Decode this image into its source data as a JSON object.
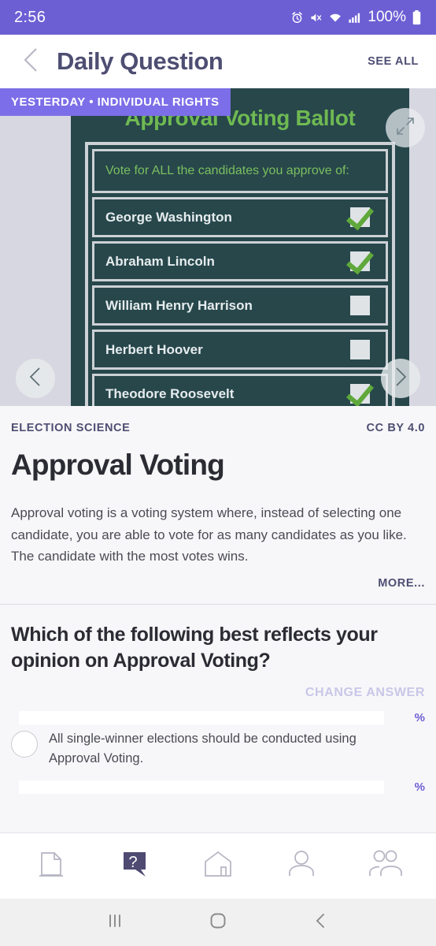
{
  "status_bar": {
    "time": "2:56",
    "battery_percent": "100%",
    "icons": [
      "alarm-icon",
      "mute-icon",
      "wifi-icon",
      "signal-icon",
      "battery-icon"
    ]
  },
  "header": {
    "back_icon": "chevron-left-icon",
    "title": "Daily Question",
    "see_all_label": "SEE ALL"
  },
  "hero": {
    "badge": "YESTERDAY  •  INDIVIDUAL RIGHTS",
    "expand_icon": "expand-icon",
    "prev_icon": "chevron-left-icon",
    "next_icon": "chevron-right-icon",
    "ballot": {
      "title": "Approval Voting Ballot",
      "prompt": "Vote for ALL the candidates you approve of:",
      "candidates": [
        {
          "name": "George Washington",
          "checked": true
        },
        {
          "name": "Abraham Lincoln",
          "checked": true
        },
        {
          "name": "William Henry Harrison",
          "checked": false
        },
        {
          "name": "Herbert Hoover",
          "checked": false
        },
        {
          "name": "Theodore Roosevelt",
          "checked": true
        }
      ]
    },
    "colors": {
      "ballot_bg": "#27474b",
      "ballot_green": "#6fb952",
      "gutter": "#d7d7e1"
    }
  },
  "article": {
    "category": "ELECTION SCIENCE",
    "license": "CC BY 4.0",
    "title": "Approval Voting",
    "body": "Approval voting is a voting system where, instead of selecting one candidate, you are able to vote for as many candidates as you like. The candidate with the most votes wins.",
    "more_label": "MORE..."
  },
  "question": {
    "text": "Which of the following best reflects your opinion on Approval Voting?",
    "change_answer_label": "CHANGE ANSWER",
    "options": [
      {
        "label": "All single-winner elections should be conducted using Approval Voting.",
        "percent": "%",
        "selected": false
      },
      {
        "label": "",
        "percent": "%",
        "selected": false
      }
    ]
  },
  "bottom_nav": {
    "items": [
      {
        "name": "document-icon",
        "active": false
      },
      {
        "name": "question-bubble-icon",
        "active": true
      },
      {
        "name": "home-icon",
        "active": false
      },
      {
        "name": "person-icon",
        "active": false
      },
      {
        "name": "people-icon",
        "active": false
      }
    ],
    "active_color": "#4e4a72"
  },
  "android_nav": {
    "recents_icon": "recents-icon",
    "home_icon": "home-circle-icon",
    "back_icon": "back-chevron-icon"
  },
  "colors": {
    "status_purple": "#6c5fd4",
    "badge_purple": "#7c6ee8",
    "accent_purple": "#4e4e73",
    "page_bg": "#f7f7f9"
  }
}
